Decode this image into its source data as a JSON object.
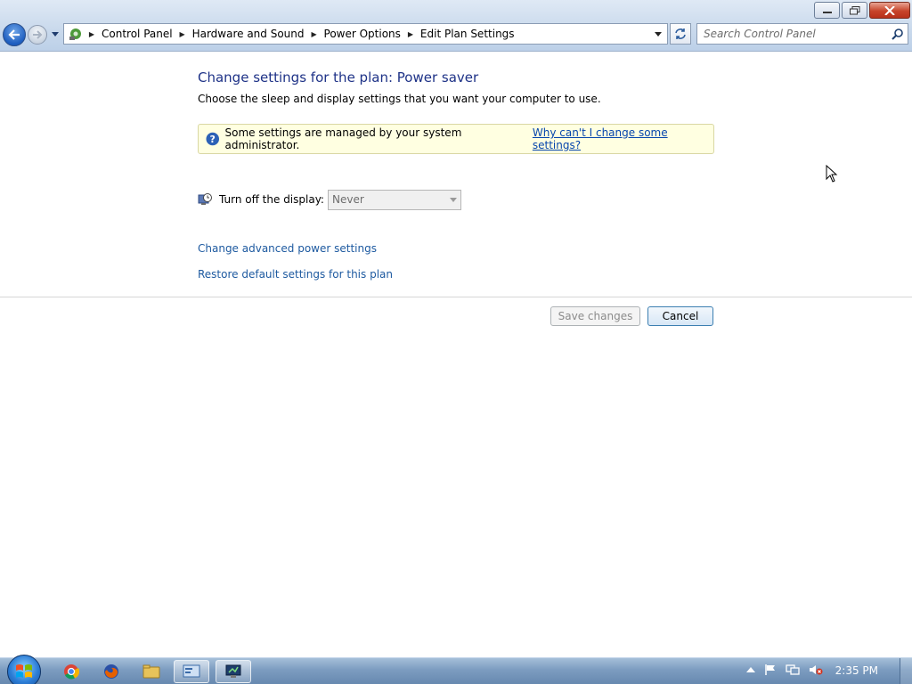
{
  "window": {
    "controls": {
      "minimize": "minimize",
      "restore": "restore",
      "close": "close"
    }
  },
  "address_bar": {
    "breadcrumbs": [
      "Control Panel",
      "Hardware and Sound",
      "Power Options",
      "Edit Plan Settings"
    ]
  },
  "search": {
    "placeholder": "Search Control Panel"
  },
  "main": {
    "title": "Change settings for the plan: Power saver",
    "description": "Choose the sleep and display settings that you want your computer to use.",
    "info_bar": {
      "text": "Some settings are managed by your system administrator.",
      "link": "Why can't I change some settings?"
    },
    "display_setting": {
      "label": "Turn off the display:",
      "value": "Never"
    },
    "links": {
      "advanced": "Change advanced power settings",
      "restore": "Restore default settings for this plan"
    },
    "buttons": {
      "save": "Save changes",
      "cancel": "Cancel"
    }
  },
  "taskbar": {
    "clock": "2:35 PM",
    "pinned": [
      "chrome-icon",
      "firefox-icon",
      "explorer-icon",
      "control-panel-icon",
      "monitor-app-icon"
    ]
  },
  "colors": {
    "title_blue": "#1e3287",
    "link_blue": "#1e5aa0",
    "info_bg": "#ffffe1"
  }
}
